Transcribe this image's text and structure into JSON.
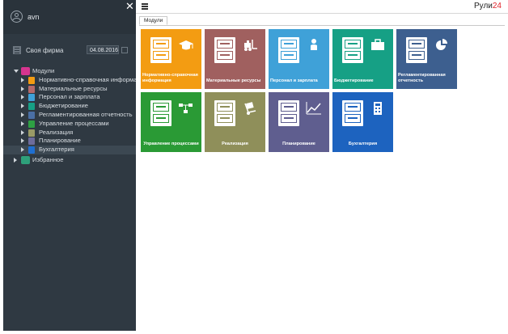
{
  "sidebar": {
    "username": "avn",
    "close_glyph": "✕",
    "firm_label": "Своя фирма",
    "firm_date": "04.08.2016",
    "tree": {
      "root_label": "Модули",
      "items": [
        {
          "label": "Нормативно-справочная информация",
          "color": "#f39c12"
        },
        {
          "label": "Материальные ресурсы",
          "color": "#b56a6a"
        },
        {
          "label": "Персонал и зарплата",
          "color": "#3fa1d8"
        },
        {
          "label": "Бюджетирование",
          "color": "#16a085"
        },
        {
          "label": "Регламентированная отчетность",
          "color": "#4a6fa5"
        },
        {
          "label": "Управление процессами",
          "color": "#2ea043"
        },
        {
          "label": "Реализация",
          "color": "#9a9a66"
        },
        {
          "label": "Планирование",
          "color": "#6d6c9b"
        },
        {
          "label": "Бухгалтерия",
          "color": "#1f6fd1"
        }
      ],
      "favorites_label": "Избранное"
    }
  },
  "topbar": {
    "brand": "Рули",
    "brand_accent": "24"
  },
  "tabs": [
    {
      "label": "Модули"
    }
  ],
  "tiles": [
    {
      "label": "Нормативно-справочная информация",
      "color": "#f39c12",
      "icon": "graduation-cap-icon"
    },
    {
      "label": "Материальные ресурсы",
      "color": "#a0605f",
      "icon": "forklift-icon"
    },
    {
      "label": "Персонал и зарплата",
      "color": "#3fa1d8",
      "icon": "person-icon"
    },
    {
      "label": "Бюджетирование",
      "color": "#16a085",
      "icon": "briefcase-icon"
    },
    {
      "label": "Регламентированная отчетность",
      "color": "#3d5f8f",
      "icon": "pie-chart-icon"
    },
    {
      "label": "Управление процессами",
      "color": "#2a9a35",
      "icon": "flowchart-icon"
    },
    {
      "label": "Реализация",
      "color": "#8f8f5a",
      "icon": "hand-truck-icon"
    },
    {
      "label": "Планирование",
      "color": "#5f5e8f",
      "icon": "trend-chart-icon"
    },
    {
      "label": "Бухгалтерия",
      "color": "#1d63bf",
      "icon": "calculator-icon"
    }
  ]
}
